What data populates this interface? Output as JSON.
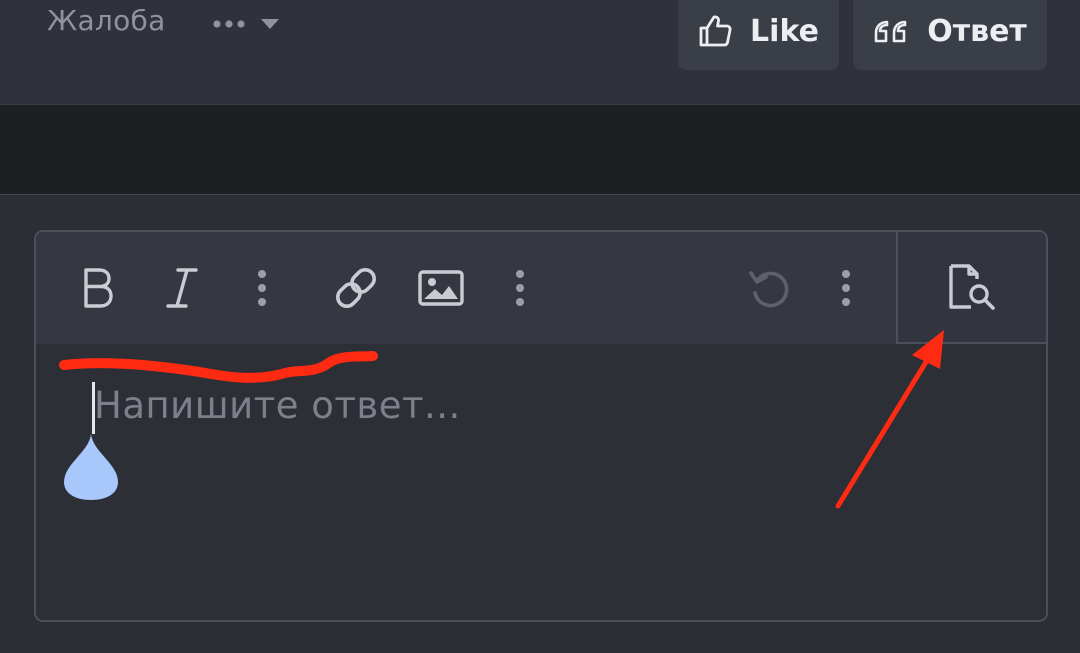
{
  "post_actions": {
    "report_label": "Жалоба",
    "more_icon": "ellipsis-icon",
    "dropdown_icon": "caret-down-icon",
    "like_label": "Like",
    "like_icon": "thumbs-up-icon",
    "reply_label": "Ответ",
    "reply_icon": "quote-icon"
  },
  "editor": {
    "toolbar": [
      {
        "name": "bold",
        "icon": "bold-icon"
      },
      {
        "name": "italic",
        "icon": "italic-icon"
      },
      {
        "name": "more-text-options",
        "icon": "vertical-dots-icon"
      },
      {
        "name": "insert-link",
        "icon": "link-icon"
      },
      {
        "name": "insert-image",
        "icon": "image-icon"
      },
      {
        "name": "more-insert-options",
        "icon": "vertical-dots-icon"
      },
      {
        "name": "undo",
        "icon": "undo-icon",
        "disabled": true
      },
      {
        "name": "more-options",
        "icon": "vertical-dots-icon"
      }
    ],
    "preview_icon": "document-search-icon",
    "placeholder": "Напишите ответ...",
    "value": ""
  },
  "annotations": {
    "underline_color": "#ff2a12",
    "arrow_color": "#ff2a12"
  },
  "colors": {
    "background": "#2b2e35",
    "toolbar": "#353841",
    "button": "#3a3e47",
    "text": "#eceef2",
    "muted": "#8e939d",
    "cursor_handle": "#a8c7fa"
  }
}
